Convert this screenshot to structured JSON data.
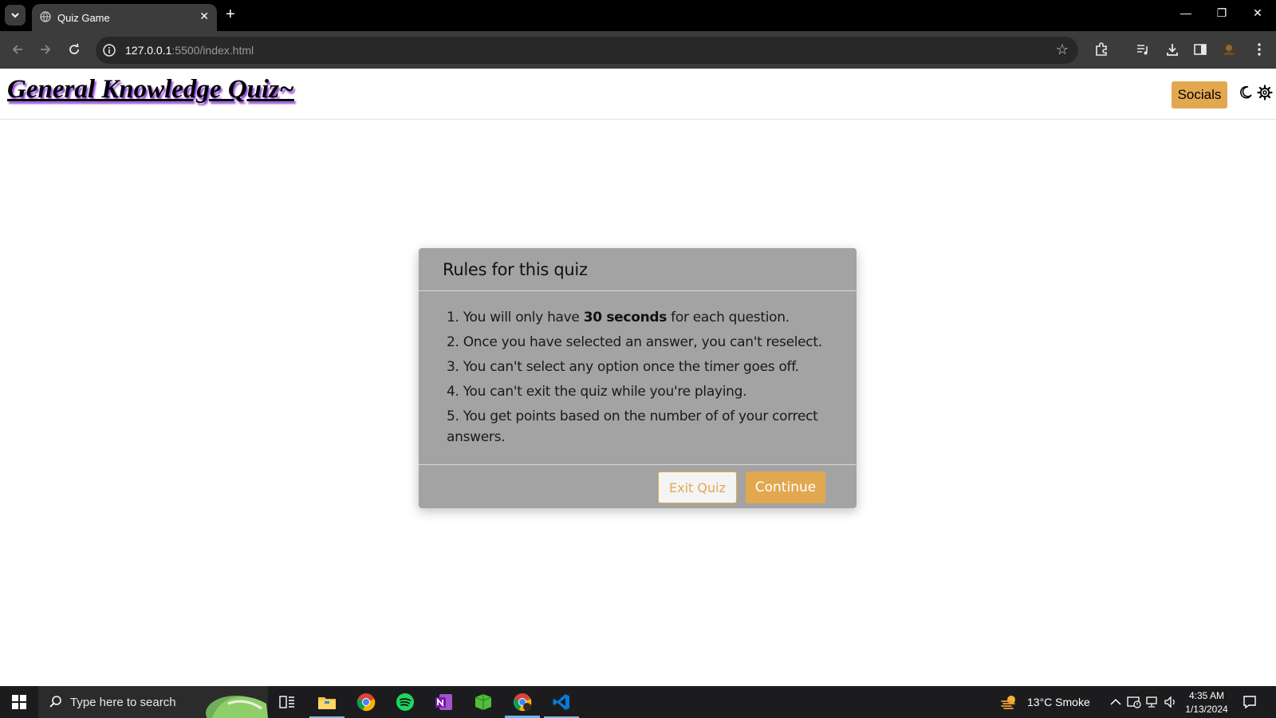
{
  "browser": {
    "tab_title": "Quiz Game",
    "url_host": "127.0.0.1",
    "url_rest": ":5500/index.html",
    "icons": {
      "tab_menu": "chevron-down-icon",
      "favicon": "globe-icon",
      "close_tab": "close-icon",
      "new_tab": "plus-icon",
      "back": "arrow-left-icon",
      "forward": "arrow-right-icon",
      "reload": "reload-icon",
      "site_info": "info-icon",
      "bookmark": "star-icon",
      "extensions": "puzzle-icon",
      "media": "playlist-icon",
      "downloads": "download-icon",
      "side_panel": "side-panel-icon",
      "profile": "avatar-icon",
      "menu": "kebab-menu-icon"
    }
  },
  "site": {
    "title": "General Knowledge Quiz~",
    "socials_label": "Socials"
  },
  "modal": {
    "title": "Rules for this quiz",
    "rules": [
      {
        "prefix": "1. You will only have ",
        "bold": "30 seconds",
        "suffix": " for each question."
      },
      {
        "text": "2. Once you have selected an answer, you can't reselect."
      },
      {
        "text": "3. You can't select any option once the timer goes off."
      },
      {
        "text": "4. You can't exit the quiz while you're playing."
      },
      {
        "text": "5. You get points based on the number of of your correct answers."
      }
    ],
    "exit_label": "Exit Quiz",
    "continue_label": "Continue"
  },
  "taskbar": {
    "search_placeholder": "Type here to search",
    "weather": "13°C  Smoke",
    "time": "4:35 AM",
    "date": "1/13/2024"
  },
  "colors": {
    "accent": "#e2a84f",
    "modal_bg": "#a3a3a3",
    "title_shadow": "#8a3dd6"
  }
}
